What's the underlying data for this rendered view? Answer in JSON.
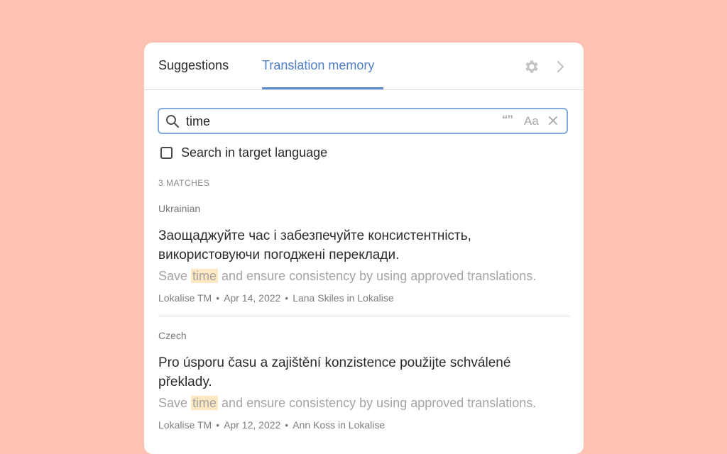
{
  "tabs": {
    "suggestions": "Suggestions",
    "translation_memory": "Translation memory"
  },
  "icons": {
    "settings": "gear-icon",
    "next": "chevron-right-icon",
    "search": "search-icon",
    "exact_match": "quote-icon",
    "match_case": "match-case-icon",
    "clear": "close-icon"
  },
  "search": {
    "value": "time",
    "quote_glyph": "“”",
    "case_label": "Aa",
    "target_language_checkbox_label": "Search in target language"
  },
  "results": {
    "count_label": "3 MATCHES",
    "items": [
      {
        "language": "Ukrainian",
        "target": "Заощаджуйте час і забезпечуйте консистентність, використовуючи погоджені переклади.",
        "source_before": "Save ",
        "source_highlight": "time",
        "source_after": " and ensure consistency by using approved translations.",
        "origin": "Lokalise TM",
        "date": "Apr 14, 2022",
        "author": "Lana Skiles in Lokalise"
      },
      {
        "language": "Czech",
        "target": "Pro úsporu času a zajištění konzistence použijte schválené překlady.",
        "source_before": "Save ",
        "source_highlight": "time",
        "source_after": " and ensure consistency by using approved translations.",
        "origin": "Lokalise TM",
        "date": "Apr 12, 2022",
        "author": "Ann Koss in Lokalise"
      }
    ]
  },
  "colors": {
    "background": "#fec2b2",
    "accent": "#4f7fc4",
    "highlight": "#fde8c1"
  }
}
